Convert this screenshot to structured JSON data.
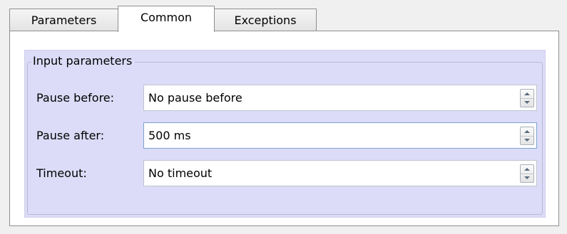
{
  "tabs": [
    {
      "label": "Parameters",
      "selected": false
    },
    {
      "label": "Common",
      "selected": true
    },
    {
      "label": "Exceptions",
      "selected": false
    }
  ],
  "group": {
    "title": "Input parameters",
    "background_color": "#dcdcf8"
  },
  "fields": [
    {
      "label": "Pause before:",
      "value": "No pause before",
      "control": "spin-box"
    },
    {
      "label": "Pause after:",
      "value": "500 ms",
      "control": "spin-box",
      "focused": true
    },
    {
      "label": "Timeout:",
      "value": "No timeout",
      "control": "spin-box"
    }
  ],
  "icons": {
    "spin_up": "spin-up-arrow-icon",
    "spin_down": "spin-down-arrow-icon"
  }
}
